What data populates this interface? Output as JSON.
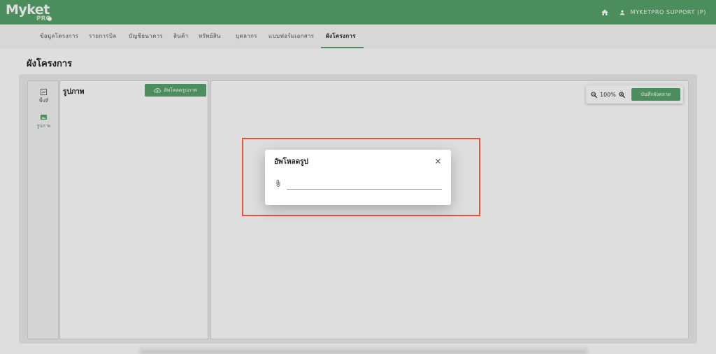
{
  "app": {
    "logo_main": "Myket",
    "logo_sub": "PRO",
    "brand_color": "#58a36c"
  },
  "header": {
    "home_icon": "home-icon",
    "user_icon": "user-icon",
    "user_name": "MYKETPRO SUPPORT (P)"
  },
  "nav": {
    "tabs": [
      {
        "label": "ข้อมูลโครงการ"
      },
      {
        "label": "รายการบิล"
      },
      {
        "label": "บัญชีธนาคาร"
      },
      {
        "label": "สินค้า"
      },
      {
        "label": "ทรัพย์สิน"
      },
      {
        "label": "บุคลากร"
      },
      {
        "label": "แบบฟอร์มเอกสาร"
      },
      {
        "label": "ผังโครงการ"
      }
    ],
    "active_tab": "ผังโครงการ"
  },
  "page": {
    "title": "ผังโครงการ"
  },
  "tools": {
    "items": [
      {
        "label": "พื้นที่",
        "icon": "area-icon"
      },
      {
        "label": "รูปภาพ",
        "icon": "image-icon"
      }
    ],
    "active": "รูปภาพ"
  },
  "image_panel": {
    "title": "รูปภาพ",
    "upload_button_label": "อัพโหลดรูปภาพ",
    "upload_icon": "cloud-upload-icon"
  },
  "canvas": {
    "zoom_level": "100%",
    "save_button_label": "บันทึกผังตลาด"
  },
  "modal": {
    "title": "อัพโหลดรูป",
    "file_input_value": "",
    "close_icon": "close-icon",
    "attach_icon": "paperclip-icon"
  },
  "colors": {
    "accent": "#58a36c",
    "highlight": "#e5533f"
  }
}
